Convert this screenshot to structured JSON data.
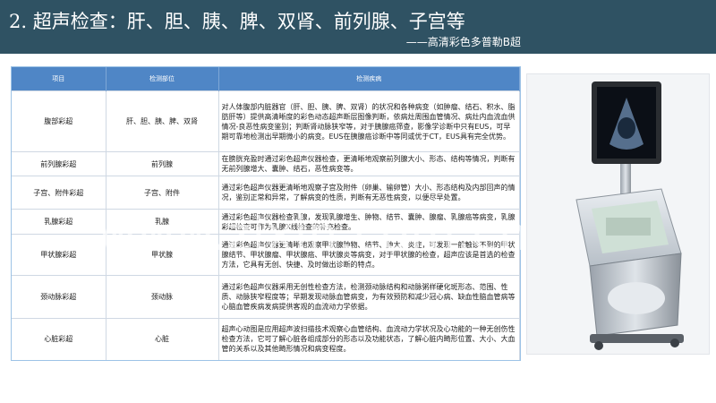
{
  "header": {
    "title": "2. 超声检查：肝、胆、胰、脾、双肾、前列腺、子宫等",
    "subtitle": "——高清彩色多普勒B超"
  },
  "table": {
    "headers": [
      "项目",
      "检测部位",
      "检测疾病"
    ],
    "rows": [
      {
        "item": "腹部彩超",
        "site": "肝、胆、胰、脾、双肾",
        "desc": "对人体腹部内脏器官（肝、胆、胰、脾、双肾）的状况和各种病变（如肿瘤、结石、积水、脂肪肝等）提供高清晰度的彩色动态超声断层图像判断，依病灶周围血管情况、病灶内血流血供情况-良恶性病变鉴别；判断肾动脉狭窄等，对于胰腺癌筛查，影像学诊断中只有EUS，可早期可靠地检测出早期微小的病变。EUS在胰腺癌诊断中等同或优于CT，EUS具有完全优势。"
      },
      {
        "item": "前列腺彩超",
        "site": "前列腺",
        "desc": "在膀胱充盈时通过彩色超声仪器检查，更清晰地观察前列腺大小、形态、结构等情况，判断有无前列腺增大、囊肿、结石，恶性病变等。"
      },
      {
        "item": "子宫、附件彩超",
        "site": "子宫、附件",
        "desc": "通过彩色超声仪器更清晰地观察子宫及附件（卵巢、输卵管）大小、形态结构及内部回声的情况，鉴别正常和异常，了解病变的性质，判断有无恶性病变，以便尽早处置。"
      },
      {
        "item": "乳腺彩超",
        "site": "乳腺",
        "desc": "通过彩色超声仪器检查乳腺，发现乳腺增生、肿物、结节、囊肿、腺瘤、乳腺癌等病变，乳腺彩超检查可作为乳腺X线检查的补充检查。"
      },
      {
        "item": "甲状腺彩超",
        "site": "甲状腺",
        "desc": "通过彩色超声仪器更清晰地观察甲状腺肿物、结节、肿大、炎症，可发现一般触诊不到的甲状腺结节、甲状腺瘤、甲状腺癌、甲状腺炎等病变，对于甲状腺的检查，超声应该是首选的检查方法，它具有无创、快捷、及时做出诊断的特点。"
      },
      {
        "item": "颈动脉彩超",
        "site": "颈动脉",
        "desc": "通过彩色超声仪器采用无创性检查方法，检测颈动脉结构和动脉粥样硬化斑形态、范围、性质、动脉狭窄程度等；早期发现动脉血管病变，为有效预防和减少冠心病、缺血性脑血管病等心脑血管疾病发病提供客观的血流动力学依据。"
      },
      {
        "item": "心脏彩超",
        "site": "心脏",
        "desc": "超声心动图是应用超声波扫描技术观察心血管结构、血流动力学状况及心功能的一种无创伤性检查方法，它可了解心脏各组成部分的形态以及功能状态，了解心脏内畸形位置、大小、大血管的关系以及其他畸形情况和病变程度。"
      }
    ]
  },
  "watermark": "www.zixin.com.cn"
}
